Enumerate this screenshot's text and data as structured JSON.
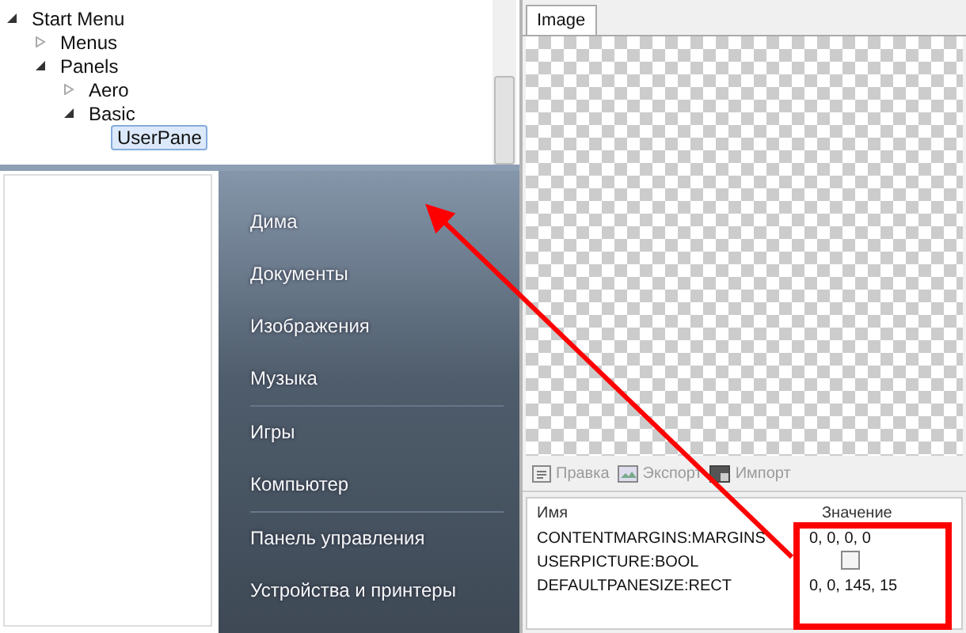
{
  "tree": [
    {
      "label": "Start Menu",
      "expanded": true,
      "selected": false,
      "children": [
        {
          "label": "Menus",
          "expanded": false,
          "selected": false
        },
        {
          "label": "Panels",
          "expanded": true,
          "selected": false,
          "children": [
            {
              "label": "Aero",
              "expanded": false,
              "selected": false
            },
            {
              "label": "Basic",
              "expanded": true,
              "selected": false,
              "children": [
                {
                  "label": "UserPane",
                  "selected": true
                }
              ]
            }
          ]
        }
      ]
    }
  ],
  "start_menu_preview": {
    "items": [
      {
        "label": "Дима",
        "separator_after": false
      },
      {
        "label": "Документы",
        "separator_after": false
      },
      {
        "label": "Изображения",
        "separator_after": false
      },
      {
        "label": "Музыка",
        "separator_after": true
      },
      {
        "label": "Игры",
        "separator_after": false
      },
      {
        "label": "Компьютер",
        "separator_after": true
      },
      {
        "label": "Панель управления",
        "separator_after": false
      },
      {
        "label": "Устройства и принтеры",
        "separator_after": false
      }
    ]
  },
  "tabs": [
    {
      "label": "Image",
      "selected": true
    }
  ],
  "toolbar": [
    {
      "label": "Правка",
      "kind": "edit",
      "disabled": true
    },
    {
      "label": "Экспорт",
      "kind": "export",
      "disabled": true
    },
    {
      "label": "Импорт",
      "kind": "import",
      "disabled": true
    }
  ],
  "properties": {
    "columns": [
      "Имя",
      "Значение"
    ],
    "rows": [
      {
        "name": "CONTENTMARGINS:MARGINS",
        "kind": "text",
        "value": "0, 0, 0, 0"
      },
      {
        "name": "USERPICTURE:BOOL",
        "kind": "checkbox",
        "checked": false
      },
      {
        "name": "DEFAULTPANESIZE:RECT",
        "kind": "text",
        "value": "0, 0, 145, 15"
      }
    ]
  }
}
